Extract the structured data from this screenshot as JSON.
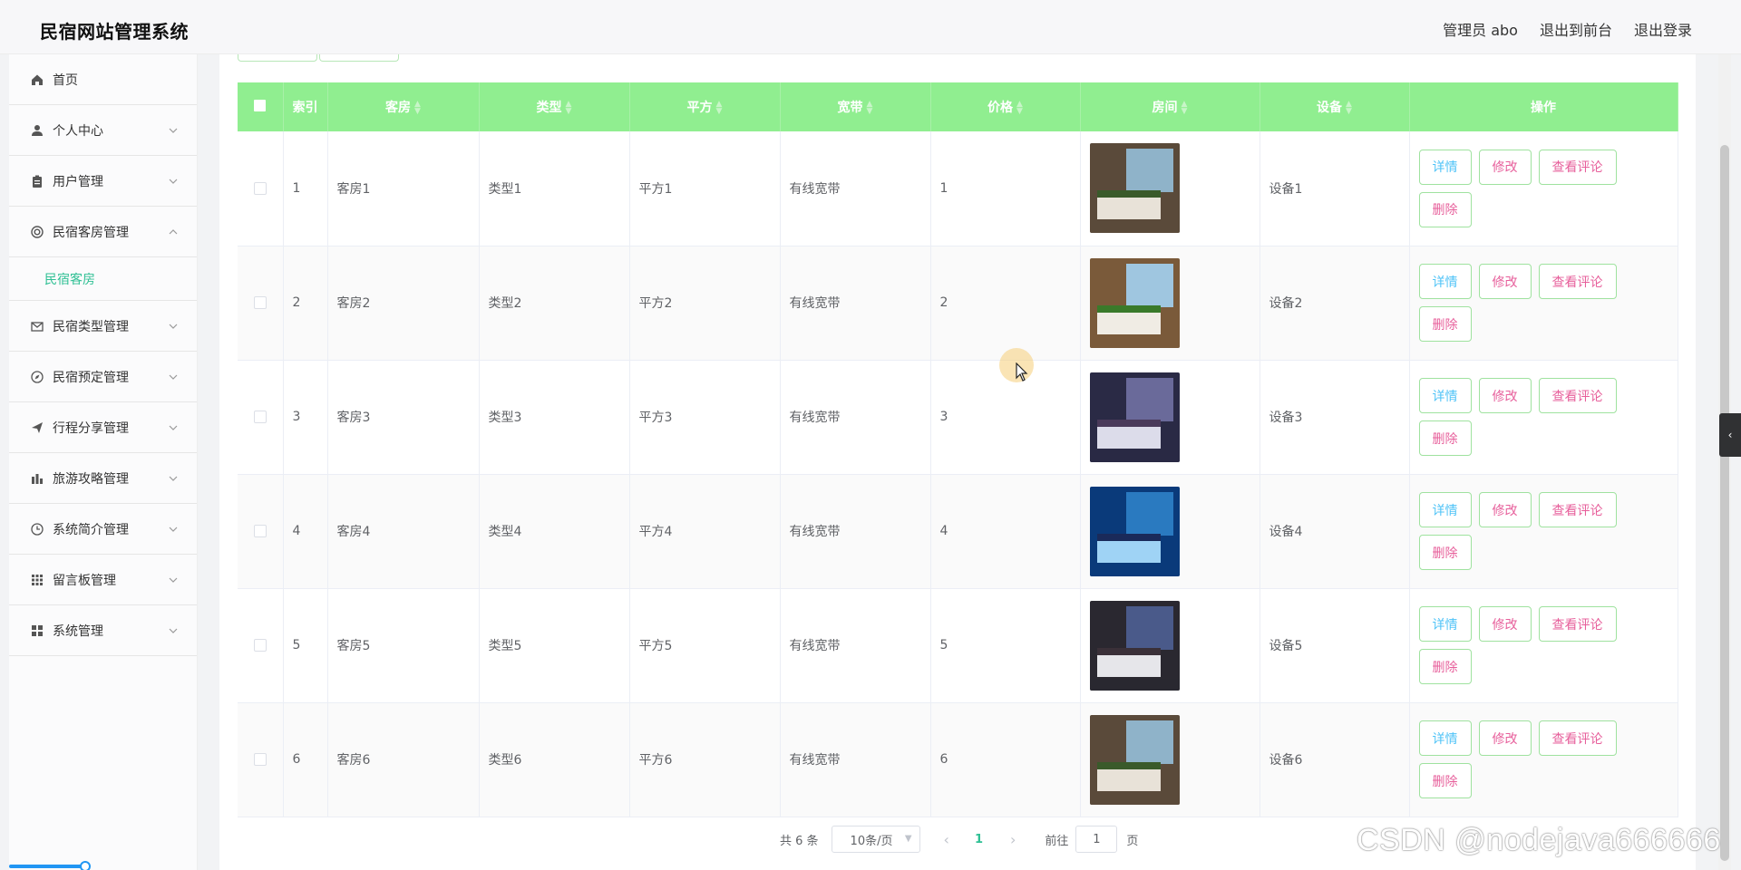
{
  "header": {
    "title": "民宿网站管理系统",
    "user": "管理员 abo",
    "to_front": "退出到前台",
    "logout": "退出登录"
  },
  "sidebar": {
    "items": [
      {
        "label": "首页",
        "icon": "home-icon"
      },
      {
        "label": "个人中心",
        "icon": "user-icon"
      },
      {
        "label": "用户管理",
        "icon": "clipboard-icon"
      },
      {
        "label": "民宿客房管理",
        "icon": "lifebuoy-icon",
        "expanded": true
      },
      {
        "label": "民宿类型管理",
        "icon": "mail-icon"
      },
      {
        "label": "民宿预定管理",
        "icon": "compass-icon"
      },
      {
        "label": "行程分享管理",
        "icon": "send-icon"
      },
      {
        "label": "旅游攻略管理",
        "icon": "chart-icon"
      },
      {
        "label": "系统简介管理",
        "icon": "clock-icon"
      },
      {
        "label": "留言板管理",
        "icon": "grid-icon"
      },
      {
        "label": "系统管理",
        "icon": "apps-icon"
      }
    ],
    "sub_active": "民宿客房"
  },
  "table": {
    "headers": [
      "索引",
      "客房",
      "类型",
      "平方",
      "宽带",
      "价格",
      "房间",
      "设备",
      "操作"
    ],
    "rows": [
      {
        "index": "1",
        "room": "客房1",
        "type": "类型1",
        "area": "平方1",
        "net": "有线宽带",
        "price": "1",
        "device": "设备1"
      },
      {
        "index": "2",
        "room": "客房2",
        "type": "类型2",
        "area": "平方2",
        "net": "有线宽带",
        "price": "2",
        "device": "设备2"
      },
      {
        "index": "3",
        "room": "客房3",
        "type": "类型3",
        "area": "平方3",
        "net": "有线宽带",
        "price": "3",
        "device": "设备3"
      },
      {
        "index": "4",
        "room": "客房4",
        "type": "类型4",
        "area": "平方4",
        "net": "有线宽带",
        "price": "4",
        "device": "设备4"
      },
      {
        "index": "5",
        "room": "客房5",
        "type": "类型5",
        "area": "平方5",
        "net": "有线宽带",
        "price": "5",
        "device": "设备5"
      },
      {
        "index": "6",
        "room": "客房6",
        "type": "类型6",
        "area": "平方6",
        "net": "有线宽带",
        "price": "6",
        "device": "设备6"
      }
    ],
    "actions": {
      "detail": "详情",
      "edit": "修改",
      "review": "查看评论",
      "delete": "删除"
    }
  },
  "pagination": {
    "total": "共 6 条",
    "page_size": "10条/页",
    "current": "1",
    "goto_label": "前往",
    "goto_value": "1",
    "page_suffix": "页"
  },
  "watermark": "CSDN @nodejava666666",
  "colors": {
    "header_row": "#90ee90",
    "accent": "#2fc094",
    "detail": "#4fc3f7",
    "edit": "#e75f9b"
  }
}
